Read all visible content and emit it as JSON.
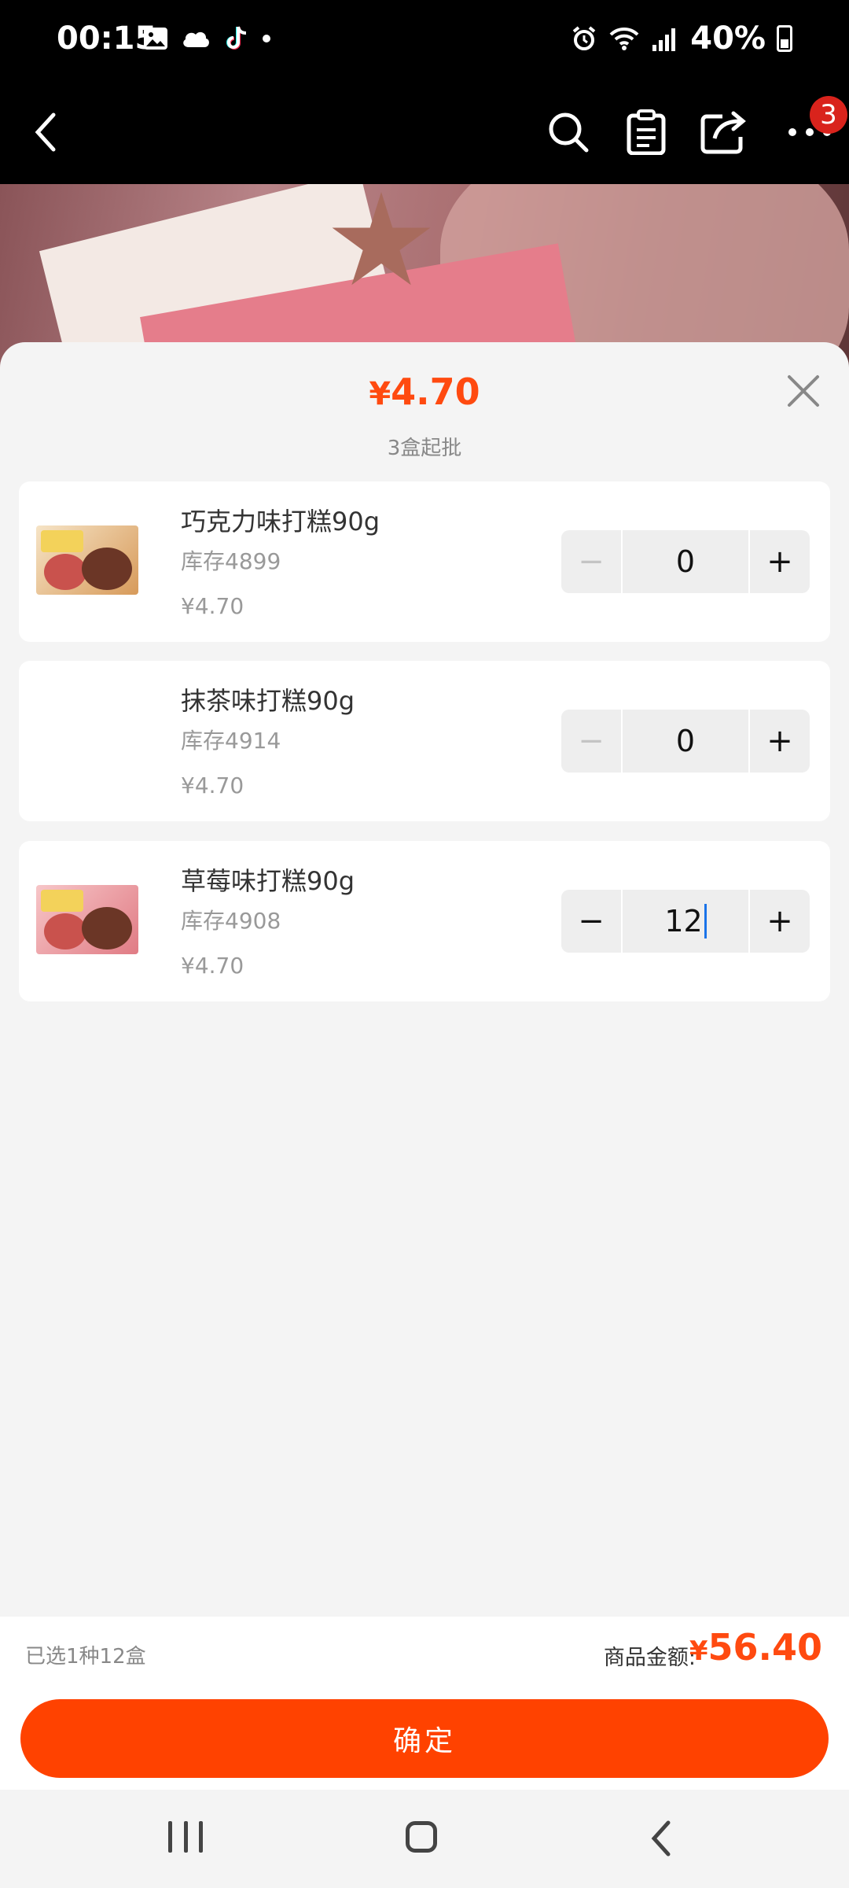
{
  "status_bar": {
    "time": "00:15",
    "battery": "40%"
  },
  "header": {
    "cart_badge": "3"
  },
  "sheet": {
    "price_symbol": "¥",
    "price": "4.70",
    "min_order": "3盒起批"
  },
  "items": [
    {
      "name": "巧克力味打糕90g",
      "stock": "库存4899",
      "price": "¥4.70",
      "qty": "0",
      "minus": "−",
      "plus": "+"
    },
    {
      "name": "抹茶味打糕90g",
      "stock": "库存4914",
      "price": "¥4.70",
      "qty": "0",
      "minus": "−",
      "plus": "+"
    },
    {
      "name": "草莓味打糕90g",
      "stock": "库存4908",
      "price": "¥4.70",
      "qty": "12",
      "minus": "−",
      "plus": "+"
    }
  ],
  "footer": {
    "selected": "已选1种12盒",
    "total_label": "商品金额:",
    "total_symbol": "¥",
    "total_value": "56.40",
    "confirm": "确定"
  },
  "colors": {
    "accent": "#ff4a10",
    "button": "#ff4200"
  }
}
